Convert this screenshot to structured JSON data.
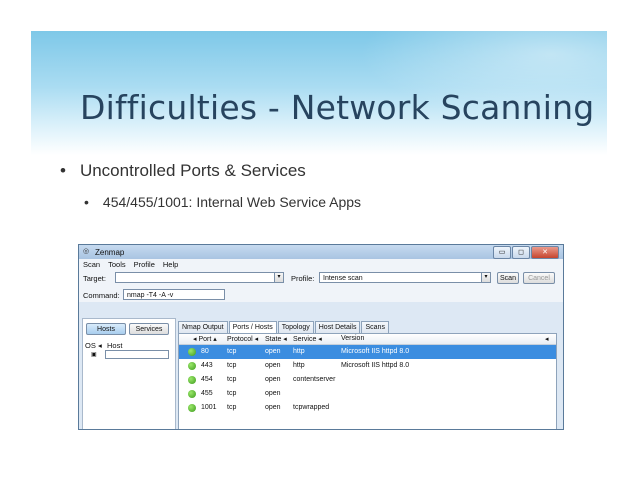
{
  "slide": {
    "title": "Difficulties - Network Scanning",
    "bullet1": "Uncontrolled Ports & Services",
    "bullet2": "454/455/1001: Internal Web Service Apps",
    "bullet_char": "•"
  },
  "window": {
    "title": "Zenmap",
    "controls": {
      "minimize": "▭",
      "maximize": "◻",
      "close": "✕"
    }
  },
  "menu": [
    "Scan",
    "Tools",
    "Profile",
    "Help"
  ],
  "toolbar": {
    "target_label": "Target:",
    "target_value": "",
    "profile_label": "Profile:",
    "profile_value": "Intense scan",
    "scan_label": "Scan",
    "cancel_label": "Cancel",
    "command_label": "Command:",
    "command_value": "nmap -T4 -A -v"
  },
  "left_panel": {
    "hosts_btn": "Hosts",
    "services_btn": "Services",
    "col_os": "OS",
    "col_host": "Host"
  },
  "tabs": [
    "Nmap Output",
    "Ports / Hosts",
    "Topology",
    "Host Details",
    "Scans"
  ],
  "ports_table": {
    "headers": {
      "port": "Port",
      "protocol": "Protocol",
      "state": "State",
      "service": "Service",
      "version": "Version"
    },
    "rows": [
      {
        "port": "80",
        "protocol": "tcp",
        "state": "open",
        "service": "http",
        "version": "Microsoft IIS httpd 8.0",
        "selected": true
      },
      {
        "port": "443",
        "protocol": "tcp",
        "state": "open",
        "service": "http",
        "version": "Microsoft IIS httpd 8.0",
        "selected": false
      },
      {
        "port": "454",
        "protocol": "tcp",
        "state": "open",
        "service": "contentserver",
        "version": "",
        "selected": false
      },
      {
        "port": "455",
        "protocol": "tcp",
        "state": "open",
        "service": "",
        "version": "",
        "selected": false
      },
      {
        "port": "1001",
        "protocol": "tcp",
        "state": "open",
        "service": "tcpwrapped",
        "version": "",
        "selected": false
      }
    ]
  },
  "colors": {
    "accent": "#3b8de0",
    "title": "#27445f",
    "status_open": "#3c9a1d"
  }
}
